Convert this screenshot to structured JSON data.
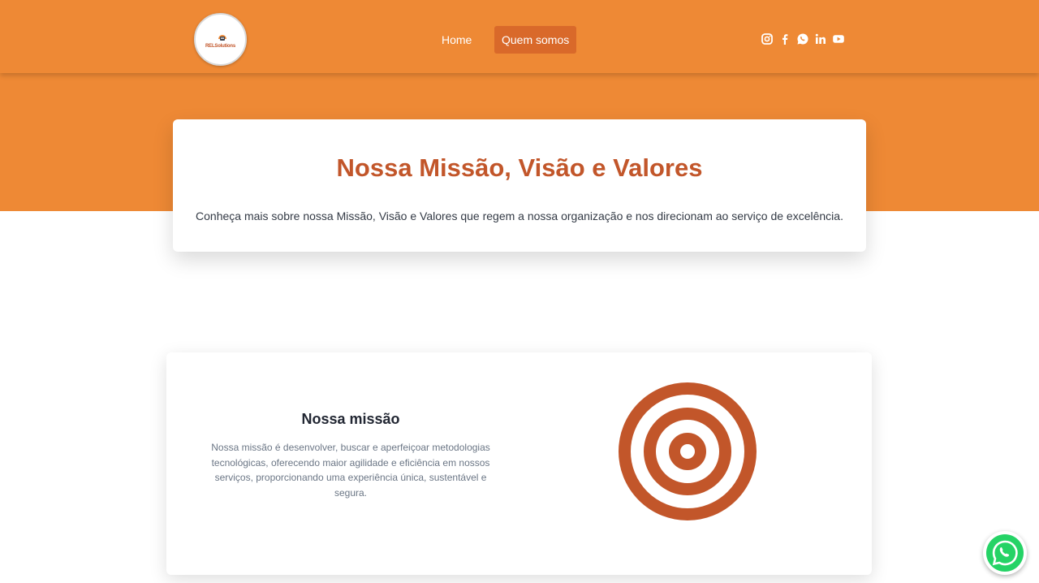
{
  "header": {
    "logo_text": "RELSolutions",
    "nav": [
      {
        "label": "Home"
      },
      {
        "label": "Quem somos",
        "active": true
      }
    ],
    "social": [
      "instagram-icon",
      "facebook-icon",
      "whatsapp-icon",
      "linkedin-icon",
      "youtube-icon"
    ]
  },
  "hero": {
    "title": "Nossa Missão, Visão e Valores",
    "subtitle": "Conheça mais sobre nossa Missão, Visão e Valores que regem a nossa organização e nos direcionam ao serviço de excelência."
  },
  "mission": {
    "title": "Nossa missão",
    "text": "Nossa missão é desenvolver, buscar e aperfeiçoar metodologias tecnológicas, oferecendo maior agilidade e eficiência em nossos serviços, proporcionando uma experiência única, sustentável e segura.",
    "icon": "target-icon"
  },
  "floating": {
    "icon": "whatsapp-icon"
  },
  "colors": {
    "primary": "#ee8935",
    "accent": "#c2562a",
    "nav_active": "#d9692a",
    "whatsapp": "#25d366"
  }
}
